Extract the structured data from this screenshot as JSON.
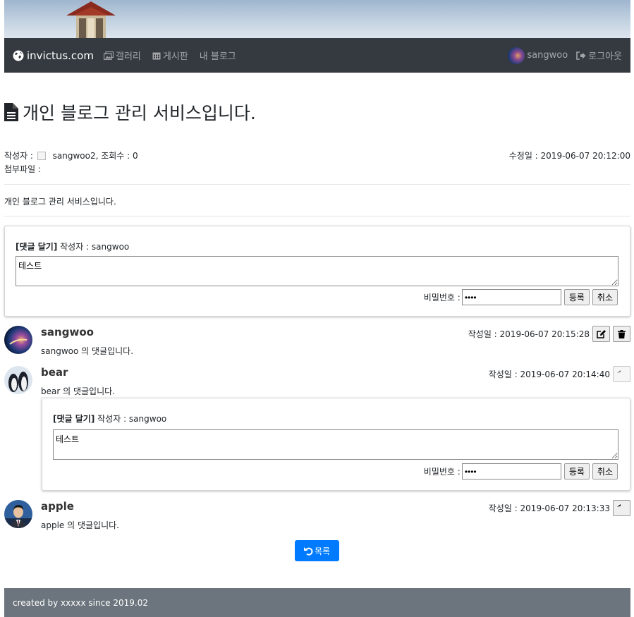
{
  "navbar": {
    "brand": "invictus.com",
    "items": [
      {
        "label": "갤러리",
        "icon": "image-icon"
      },
      {
        "label": "게시판",
        "icon": "calendar-icon"
      },
      {
        "label": "내 블로그",
        "icon": ""
      }
    ],
    "user": "sangwoo",
    "logout": "로그아웃"
  },
  "post": {
    "title": "개인 블로그 관리 서비스입니다.",
    "author_label": "작성자 :",
    "author_views": "sangwoo2, 조회수 : 0",
    "modified": "수정일 : 2019-06-07 20:12:00",
    "attachment_label": "첨부파일 :",
    "content": "개인 블로그 관리 서비스입니다."
  },
  "reply_form": {
    "title": "[댓글 달기]",
    "author": "작성자 : sangwoo",
    "text": "테스트",
    "password_label": "비밀번호 :",
    "password_value": "1234",
    "submit": "등록",
    "cancel": "취소"
  },
  "comments": [
    {
      "author": "sangwoo",
      "text": "sangwoo 의 댓글입니다.",
      "date": "작성일 : 2019-06-07 20:15:28"
    },
    {
      "author": "bear",
      "text": "bear 의 댓글입니다.",
      "date": "작성일 : 2019-06-07 20:14:40"
    },
    {
      "author": "apple",
      "text": "apple 의 댓글입니다.",
      "date": "작성일 : 2019-06-07 20:13:33"
    }
  ],
  "nested_form": {
    "title": "[댓글 달기]",
    "author": "작성자 : sangwoo",
    "text": "테스트",
    "password_label": "비밀번호 :",
    "password_value": "1234",
    "submit": "등록",
    "cancel": "취소"
  },
  "list_button": "목록",
  "footer": "created by xxxxx since 2019.02",
  "colors": {
    "navbar": "#343a40",
    "primary": "#007bff",
    "footer": "#6c757d"
  }
}
